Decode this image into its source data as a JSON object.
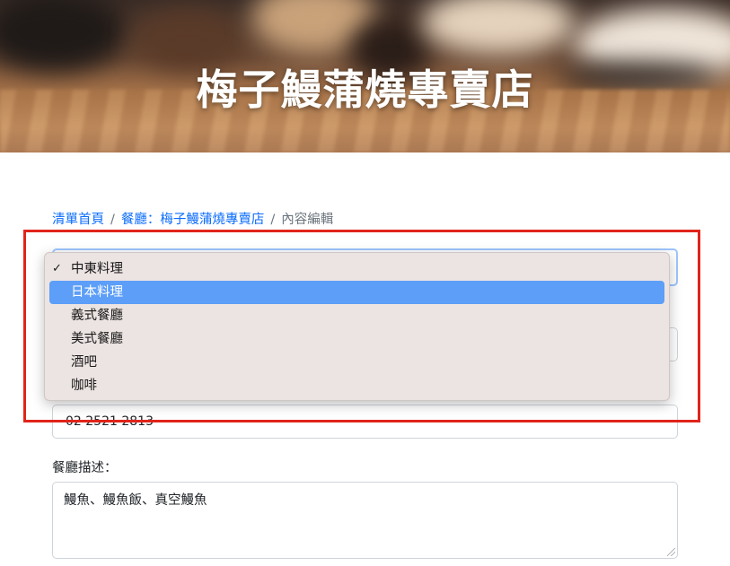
{
  "hero": {
    "title": "梅子鰻蒲燒專賣店"
  },
  "breadcrumb": {
    "home": "清單首頁",
    "separator": "/",
    "restaurant": "餐廳：梅子鰻蒲燒專賣店",
    "current": "內容編輯"
  },
  "category_select": {
    "selected": "中東料理",
    "highlighted": "日本料理",
    "check_mark": "✓",
    "options": [
      "中東料理",
      "日本料理",
      "義式餐廳",
      "美式餐廳",
      "酒吧",
      "咖啡"
    ]
  },
  "phone": {
    "value": "02 2521 2813"
  },
  "description": {
    "label": "餐廳描述：",
    "value": "鰻魚、鰻魚飯、真空鰻魚"
  },
  "colors": {
    "link": "#0d6efd",
    "highlight": "#5c9ef8",
    "dropdown_bg": "#ece4e2",
    "annotation": "#e0241b"
  }
}
